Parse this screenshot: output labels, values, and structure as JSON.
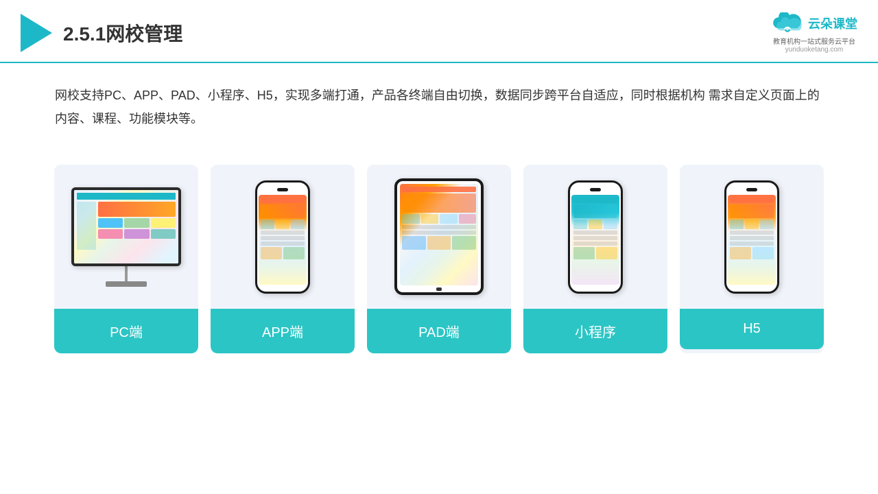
{
  "header": {
    "title": "2.5.1网校管理",
    "brand_name": "云朵课堂",
    "brand_url": "yunduoketang.com",
    "brand_tagline": "教育机构一站\n式服务云平台"
  },
  "description": {
    "text": "网校支持PC、APP、PAD、小程序、H5，实现多端打通，产品各终端自由切换，数据同步跨平台自适应，同时根据机构\n需求自定义页面上的内容、课程、功能模块等。"
  },
  "cards": [
    {
      "id": "pc",
      "label": "PC端"
    },
    {
      "id": "app",
      "label": "APP端"
    },
    {
      "id": "pad",
      "label": "PAD端"
    },
    {
      "id": "miniprogram",
      "label": "小程序"
    },
    {
      "id": "h5",
      "label": "H5"
    }
  ],
  "colors": {
    "accent": "#1db8c8",
    "card_bg": "#eef2f8",
    "label_bg": "#2cc5c5",
    "label_text": "#ffffff",
    "title_color": "#333333",
    "desc_color": "#333333"
  }
}
